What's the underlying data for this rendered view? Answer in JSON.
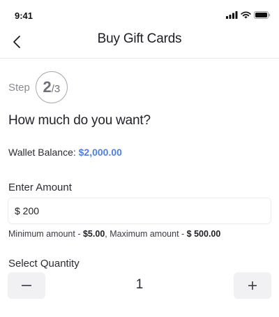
{
  "status_bar": {
    "time": "9:41",
    "icons": [
      "cellular-signal-icon",
      "wifi-icon",
      "battery-icon"
    ]
  },
  "header": {
    "back_icon": "chevron-left-icon",
    "title": "Buy Gift Cards"
  },
  "step": {
    "label": "Step",
    "current": "2",
    "separator": "/",
    "total": "3"
  },
  "question": "How much do you want?",
  "wallet": {
    "label": "Wallet Balance: ",
    "value": "$2,000.00",
    "value_color": "#4f7fe0"
  },
  "amount": {
    "label": "Enter Amount",
    "value": "$ 200"
  },
  "limits": {
    "min_label": "Minimum amount - ",
    "min_value": "$5.00",
    "separator": ", ",
    "max_label": "Maximum amount - ",
    "max_value": "$ 500.00"
  },
  "quantity": {
    "label": "Select Quantity",
    "value": "1",
    "decrement_icon": "minus-icon",
    "increment_icon": "plus-icon"
  }
}
